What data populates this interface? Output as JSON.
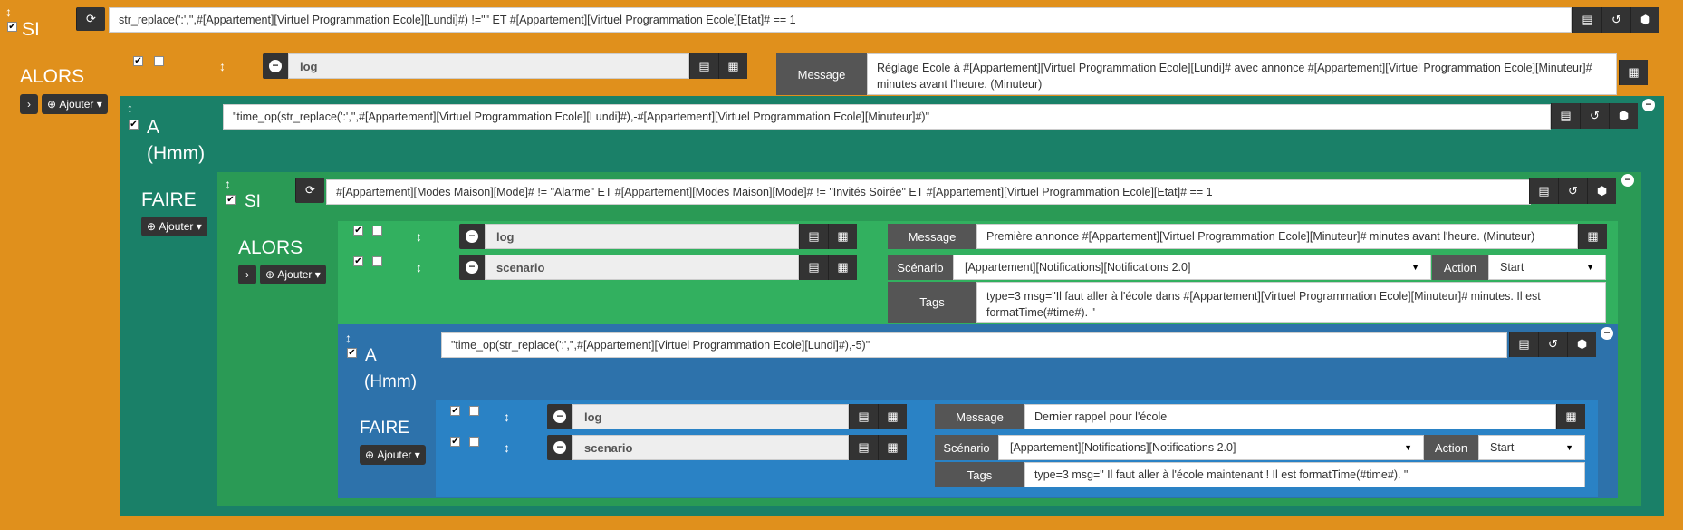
{
  "colors": {
    "orange": "#e0901c",
    "teal": "#1a8068",
    "green": "#2daa5c",
    "blue": "#2d72ab",
    "dark": "#333333"
  },
  "labels": {
    "si": "SI",
    "alors": "ALORS",
    "a": "A",
    "hmm": "(Hmm)",
    "faire": "FAIRE",
    "ajouter": "Ajouter",
    "message": "Message",
    "scenario": "Scénario",
    "action": "Action",
    "tags": "Tags"
  },
  "top": {
    "condition": "str_replace(':','',#[Appartement][Virtuel Programmation Ecole][Lundi]#) !=\"\" ET #[Appartement][Virtuel Programmation Ecole][Etat]# == 1"
  },
  "alors1": {
    "cmd": "log",
    "message": "Réglage Ecole à #[Appartement][Virtuel Programmation Ecole][Lundi]# avec annonce #[Appartement][Virtuel Programmation Ecole][Minuteur]# minutes avant l'heure. (Minuteur)"
  },
  "a1": {
    "expr": "\"time_op(str_replace(':','',#[Appartement][Virtuel Programmation Ecole][Lundi]#),-#[Appartement][Virtuel Programmation Ecole][Minuteur]#)\""
  },
  "si2": {
    "condition": "#[Appartement][Modes Maison][Mode]# != \"Alarme\" ET #[Appartement][Modes Maison][Mode]# != \"Invités Soirée\" ET #[Appartement][Virtuel Programmation Ecole][Etat]# == 1"
  },
  "alors2": {
    "row1": {
      "cmd": "log",
      "message": "Première annonce #[Appartement][Virtuel Programmation Ecole][Minuteur]# minutes avant l'heure. (Minuteur)"
    },
    "row2": {
      "cmd": "scenario",
      "scenario": "[Appartement][Notifications][Notifications 2.0]",
      "action": "Start",
      "tags": "type=3 msg=\"Il faut aller à l'école dans #[Appartement][Virtuel Programmation Ecole][Minuteur]# minutes.  Il est formatTime(#time#). \""
    }
  },
  "a2": {
    "expr": "\"time_op(str_replace(':','',#[Appartement][Virtuel Programmation Ecole][Lundi]#),-5)\""
  },
  "faire2": {
    "row1": {
      "cmd": "log",
      "message": "Dernier rappel pour l'école"
    },
    "row2": {
      "cmd": "scenario",
      "scenario": "[Appartement][Notifications][Notifications 2.0]",
      "action": "Start",
      "tags": "type=3 msg=\" Il faut aller à l'école maintenant !  Il est formatTime(#time#). \""
    }
  }
}
